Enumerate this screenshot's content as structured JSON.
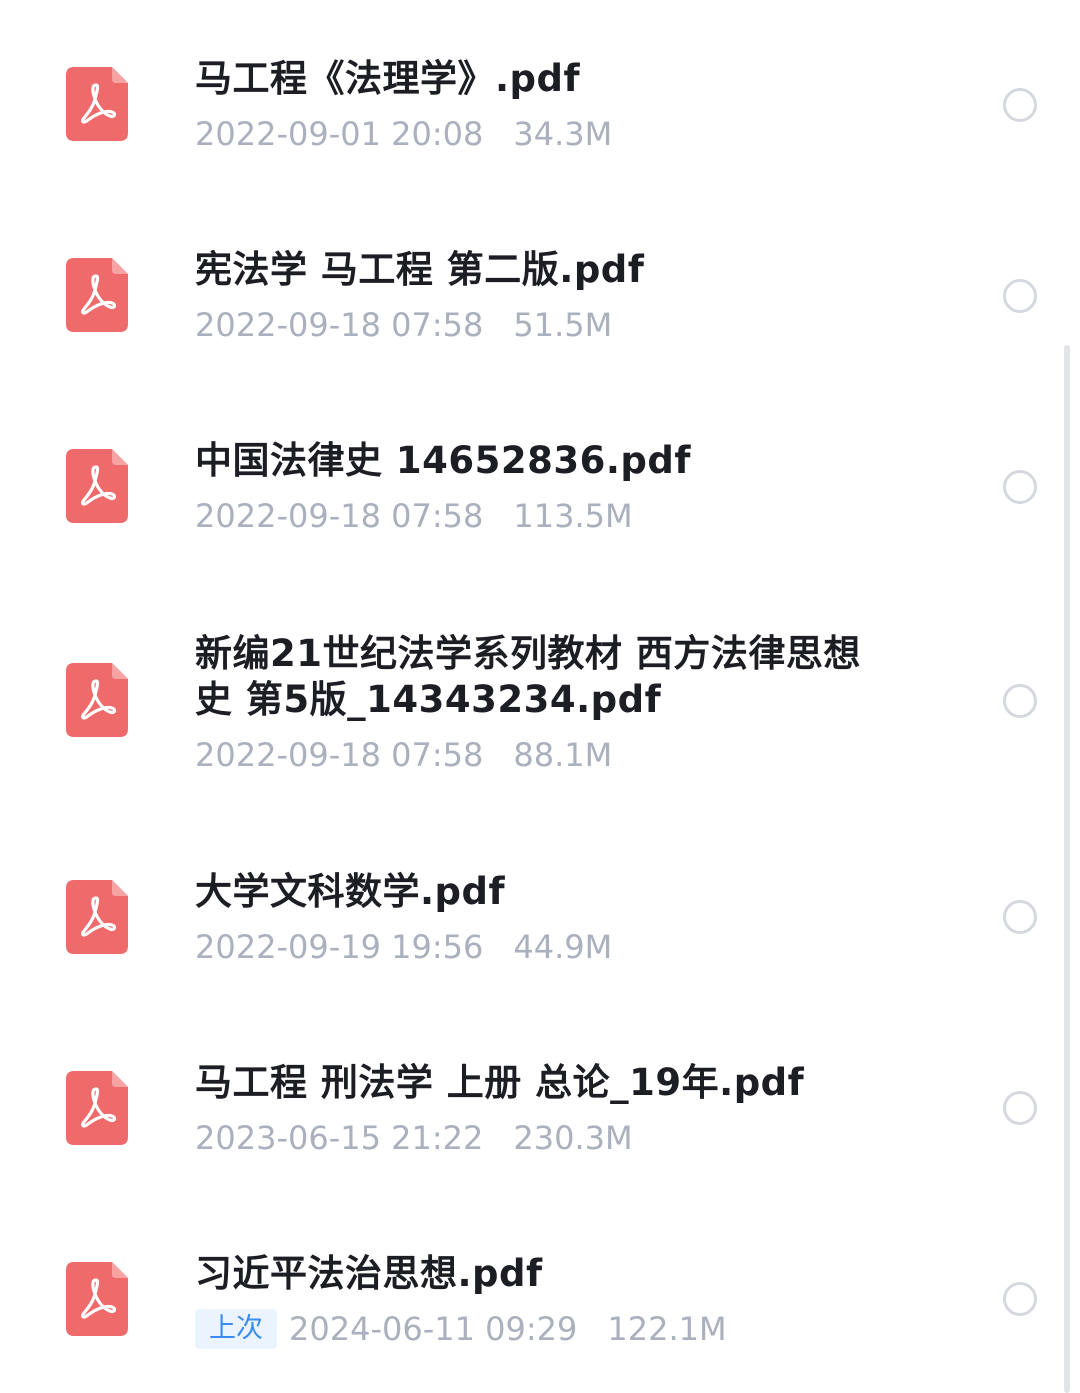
{
  "files": [
    {
      "name": "马工程《法理学》.pdf",
      "date": "2022-09-01 20:08",
      "size": "34.3M"
    },
    {
      "name": "宪法学 马工程 第二版.pdf",
      "date": "2022-09-18 07:58",
      "size": "51.5M"
    },
    {
      "name": "中国法律史 14652836.pdf",
      "date": "2022-09-18 07:58",
      "size": "113.5M"
    },
    {
      "name": "新编21世纪法学系列教材 西方法律思想\n史 第5版_14343234.pdf",
      "date": "2022-09-18 07:58",
      "size": "88.1M"
    },
    {
      "name": "大学文科数学.pdf",
      "date": "2022-09-19 19:56",
      "size": "44.9M"
    },
    {
      "name": "马工程 刑法学 上册 总论_19年.pdf",
      "date": "2023-06-15 21:22",
      "size": "230.3M"
    },
    {
      "name": "习近平法治思想.pdf",
      "date": "2024-06-11 09:29",
      "size": "122.1M",
      "badge": "上次"
    }
  ],
  "colors": {
    "pdf_icon": "#ef6b6b",
    "badge_text": "#3a8cf2",
    "badge_bg": "#eaf3fe"
  },
  "icons": {
    "file": "pdf-file-icon",
    "select": "radio-circle"
  }
}
